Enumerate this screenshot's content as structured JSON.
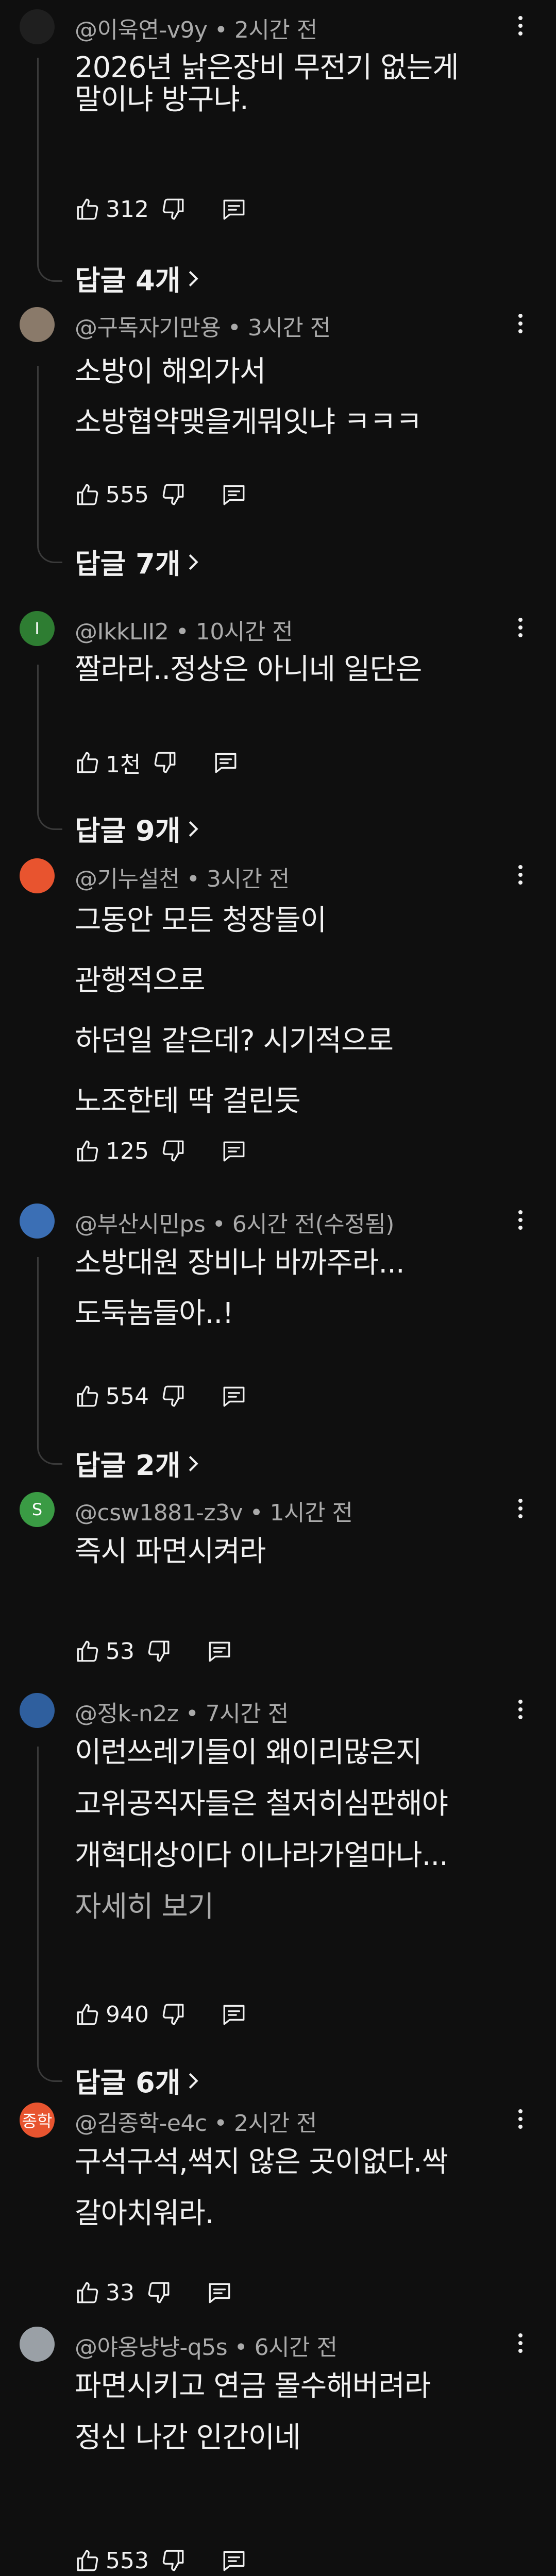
{
  "comments": [
    {
      "avatar_text": "",
      "avatar_color": "#1f1f1f",
      "author": "@이욱연-v9y",
      "time": "2시간 전",
      "lines": [
        "2026년 낡은장비 무전기 없는게",
        "말이냐 방구냐."
      ],
      "read_more": "",
      "likes": "312",
      "replies": "답글 4개"
    },
    {
      "avatar_text": "",
      "avatar_color": "#8a7a6a",
      "author": "@구독자기만용",
      "time": "3시간 전",
      "lines": [
        "소방이 해외가서",
        "소방협약맺을게뭐잇냐 ㅋㅋㅋ"
      ],
      "read_more": "",
      "likes": "555",
      "replies": "답글 7개"
    },
    {
      "avatar_text": "I",
      "avatar_color": "#2e7d32",
      "author": "@IkkLII2",
      "time": "10시간 전",
      "lines": [
        "짤라라..정상은 아니네 일단은"
      ],
      "read_more": "",
      "likes": "1천",
      "replies": "답글 9개"
    },
    {
      "avatar_text": "",
      "avatar_color": "#e8542f",
      "author": "@기누설천",
      "time": "3시간 전",
      "lines": [
        "그동안  모든 청장들이",
        "관행적으로",
        "하던일 같은데? 시기적으로",
        "노조한테 딱 걸린듯"
      ],
      "read_more": "",
      "likes": "125",
      "replies": ""
    },
    {
      "avatar_text": "",
      "avatar_color": "#3b6fb5",
      "author": "@부산시민ps",
      "time": "6시간 전(수정됨)",
      "lines": [
        "소방대원 장비나 바까주라...",
        "도둑놈들아..!"
      ],
      "read_more": "",
      "likes": "554",
      "replies": "답글 2개"
    },
    {
      "avatar_text": "S",
      "avatar_color": "#3a9b44",
      "author": "@csw1881-z3v",
      "time": "1시간 전",
      "lines": [
        "즉시 파면시켜라"
      ],
      "read_more": "",
      "likes": "53",
      "replies": ""
    },
    {
      "avatar_text": "",
      "avatar_color": "#2f5f9e",
      "author": "@정k-n2z",
      "time": "7시간 전",
      "lines": [
        "이런쓰레기들이 왜이리많은지",
        "고위공직자들은 철저히심판해야",
        "개혁대상이다 이나라가얼마나..."
      ],
      "read_more": "자세히 보기",
      "likes": "940",
      "replies": "답글 6개"
    },
    {
      "avatar_text": "종학",
      "avatar_color": "#e8542f",
      "author": "@김종학-e4c",
      "time": "2시간 전",
      "lines": [
        "구석구석,썩지   않은 곳이없다.싹",
        "갈아치워라."
      ],
      "read_more": "",
      "likes": "33",
      "replies": ""
    },
    {
      "avatar_text": "",
      "avatar_color": "#9aa0a6",
      "author": "@야옹냥냥-q5s",
      "time": "6시간 전",
      "lines": [
        "파면시키고 연금 몰수해버려라",
        "정신 나간 인간이네"
      ],
      "read_more": "",
      "likes": "553",
      "replies": ""
    }
  ]
}
